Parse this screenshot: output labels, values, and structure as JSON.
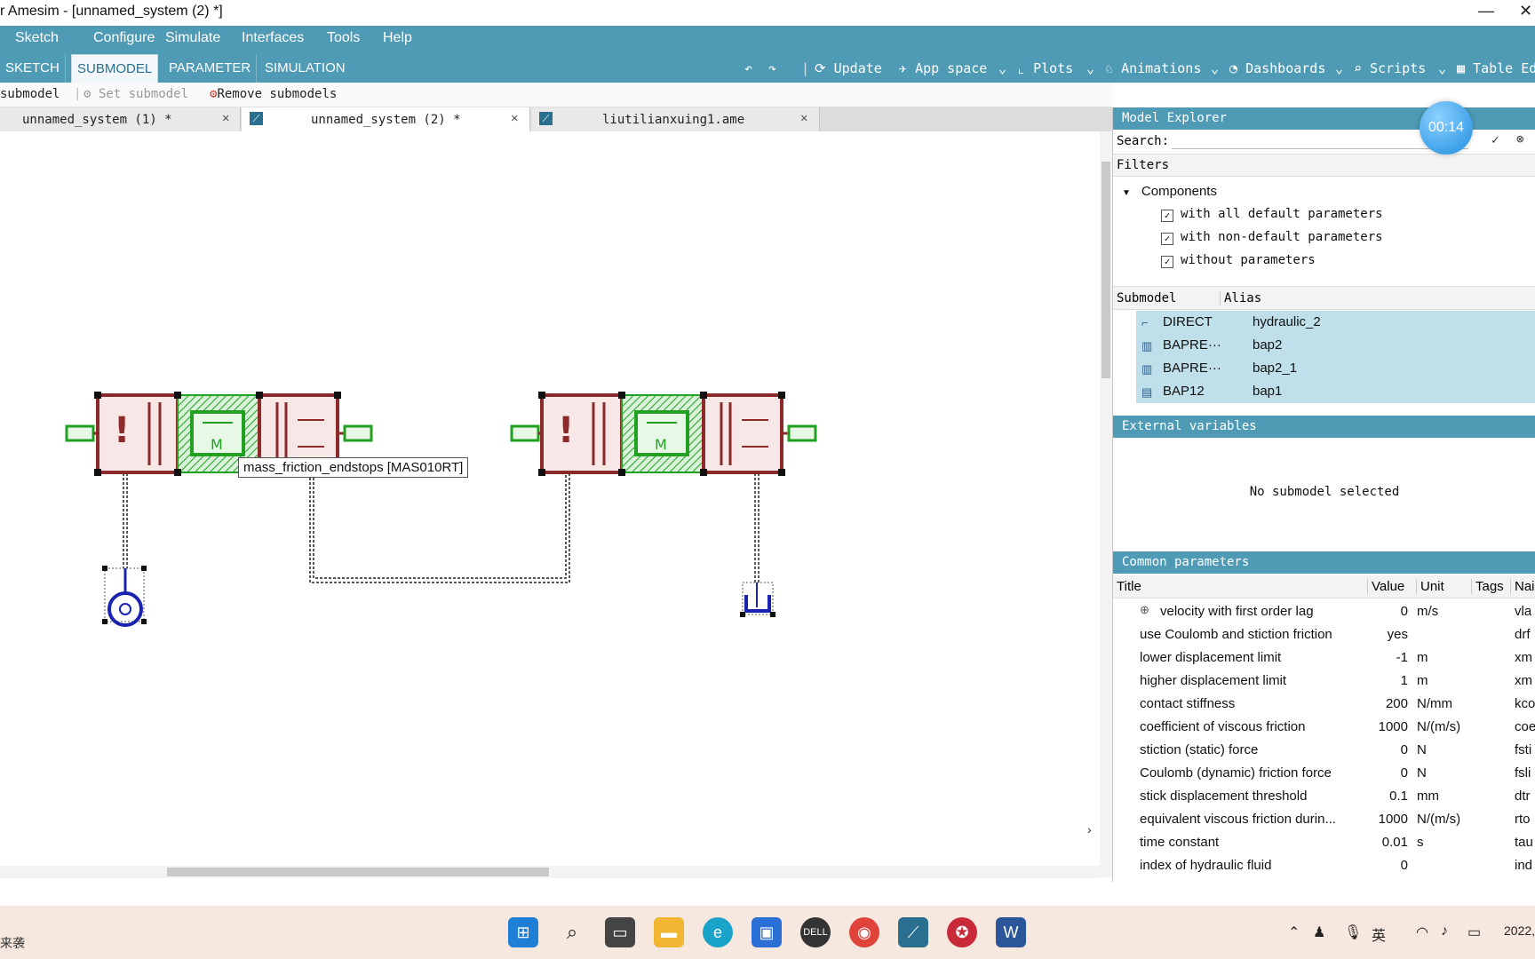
{
  "window": {
    "title": "r Amesim - [unnamed_system (2) *]"
  },
  "menu": [
    "Sketch",
    "Configure",
    "Simulate",
    "Interfaces",
    "Tools",
    "Help"
  ],
  "mode_tabs": [
    "SKETCH",
    "SUBMODEL",
    "PARAMETER",
    "SIMULATION"
  ],
  "toolbar": {
    "update": "Update",
    "app_space": "App space",
    "plots": "Plots",
    "animations": "Animations",
    "dashboards": "Dashboards",
    "scripts": "Scripts",
    "table_editor": "Table Edi"
  },
  "commands": {
    "submodel": "submodel",
    "set_submodel": "Set submodel",
    "remove_submodels": "Remove submodels"
  },
  "doc_tabs": [
    {
      "label": "unnamed_system (1) *"
    },
    {
      "label": "unnamed_system (2) *"
    },
    {
      "label": "liutilianxuing1.ame"
    }
  ],
  "tooltip": "mass_friction_endstops [MAS010RT]",
  "timer": "00:14",
  "model_explorer": {
    "title": "Model Explorer",
    "search_label": "Search:",
    "filters_label": "Filters",
    "components_label": "Components",
    "filters": [
      "with all default parameters",
      "with non-default parameters",
      "without parameters"
    ],
    "columns": [
      "Submodel",
      "Alias"
    ],
    "submodels": [
      {
        "name": "DIRECT",
        "alias": "hydraulic_2"
      },
      {
        "name": "BAPRE···",
        "alias": "bap2"
      },
      {
        "name": "BAPRE···",
        "alias": "bap2_1"
      },
      {
        "name": "BAP12",
        "alias": "bap1"
      }
    ]
  },
  "external_variables": {
    "title": "External variables",
    "empty_text": "No submodel selected"
  },
  "common_parameters": {
    "title": "Common parameters",
    "columns": [
      "Title",
      "Value",
      "Unit",
      "Tags",
      "Nai"
    ],
    "rows": [
      {
        "title": "velocity with first order lag",
        "value": "0",
        "unit": "m/s",
        "name": "vla"
      },
      {
        "title": "use Coulomb and stiction friction",
        "value": "yes",
        "unit": "",
        "name": "drf"
      },
      {
        "title": "lower displacement limit",
        "value": "-1",
        "unit": "m",
        "name": "xm"
      },
      {
        "title": "higher displacement limit",
        "value": "1",
        "unit": "m",
        "name": "xm"
      },
      {
        "title": "contact stiffness",
        "value": "200",
        "unit": "N/mm",
        "name": "kco"
      },
      {
        "title": "coefficient of viscous friction",
        "value": "1000",
        "unit": "N/(m/s)",
        "name": "coe"
      },
      {
        "title": "stiction (static) force",
        "value": "0",
        "unit": "N",
        "name": "fsti"
      },
      {
        "title": "Coulomb (dynamic) friction force",
        "value": "0",
        "unit": "N",
        "name": "fsli"
      },
      {
        "title": "stick displacement threshold",
        "value": "0.1",
        "unit": "mm",
        "name": "dtr"
      },
      {
        "title": "equivalent viscous friction durin...",
        "value": "1000",
        "unit": "N/(m/s)",
        "name": "rto"
      },
      {
        "title": "time constant",
        "value": "0.01",
        "unit": "s",
        "name": "tau"
      },
      {
        "title": "index of hydraulic fluid",
        "value": "0",
        "unit": "",
        "name": "ind"
      }
    ]
  },
  "taskbar": {
    "left_text": "来袭",
    "ime": "英",
    "clock": "2022,"
  },
  "colors": {
    "accent": "#4f9ab5",
    "selection": "#bfe0ea",
    "component_red": "#8b2a2a",
    "component_green": "#22a022",
    "component_blue": "#1a22b0"
  }
}
